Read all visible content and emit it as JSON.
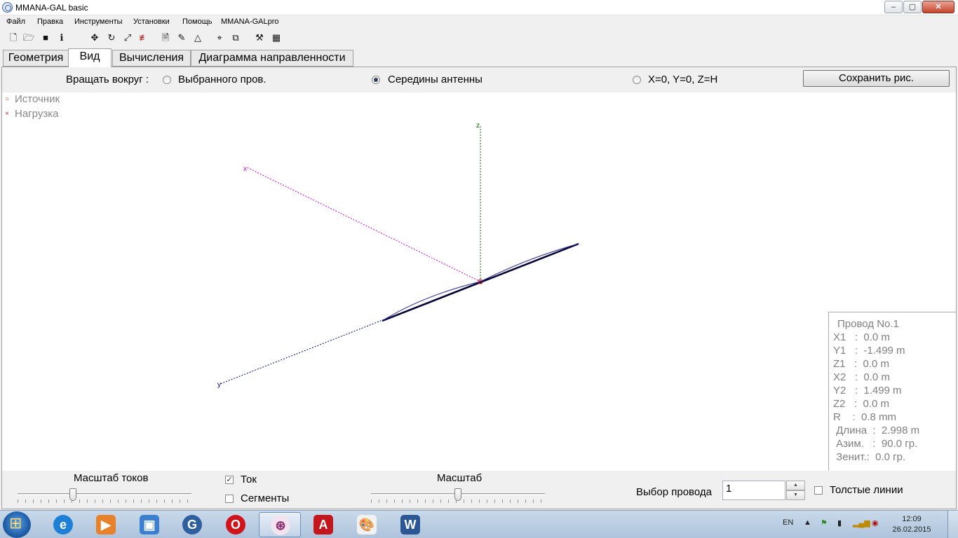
{
  "window": {
    "title": "MMANA-GAL basic"
  },
  "menu": [
    "Файл",
    "Правка",
    "Инструменты",
    "Установки",
    "Помощь",
    "MMANA-GALpro"
  ],
  "toolbar_icons": [
    "new-file-icon",
    "open-folder-icon",
    "save-icon",
    "info-icon",
    "move-icon",
    "rotate-icon",
    "scale-icon",
    "wires-icon",
    "page-icon",
    "edit-icon",
    "triangle-icon",
    "target-icon",
    "copy-icon",
    "tools-icon",
    "calculator-icon"
  ],
  "tabs": [
    "Геометрия",
    "Вид",
    "Вычисления",
    "Диаграмма направленности"
  ],
  "active_tab": "Вид",
  "rotate": {
    "label": "Вращать вокруг :",
    "options": [
      "Выбранного пров.",
      "Середины антенны",
      "X=0, Y=0, Z=H"
    ],
    "selected": "Середины антенны"
  },
  "save_button": "Сохранить рис.",
  "legend": {
    "source": "Источник",
    "load": "Нагрузка"
  },
  "wire_info": {
    "title": "Провод No.1",
    "rows": [
      "X1   :  0.0 m",
      "Y1   :  -1.499 m",
      "Z1   :  0.0 m",
      "X2   :  0.0 m",
      "Y2   :  1.499 m",
      "Z2   :  0.0 m",
      "R    :  0.8 mm",
      " Длина  :  2.998 m",
      " Азим.   :  90.0 гр.",
      " Зенит.:  0.0 гр."
    ]
  },
  "bottom": {
    "current_scale_label": "Масштаб токов",
    "current_scale_value": 0.32,
    "current_checkbox": {
      "label": "Ток",
      "checked": true
    },
    "segments_checkbox": {
      "label": "Сегменты",
      "checked": false
    },
    "scale_label": "Масштаб",
    "scale_value": 0.5,
    "wire_select_label": "Выбор провода",
    "wire_select_value": "1",
    "thick_lines": {
      "label": "Толстые линии",
      "checked": false
    }
  },
  "axes_colors": {
    "x": "#cc00cc",
    "y": "#000080",
    "z": "#006600"
  },
  "taskbar": {
    "apps": [
      "windows-explorer-icon",
      "internet-explorer-icon",
      "media-player-icon",
      "vm-icon",
      "chrome-like-icon",
      "opera-icon",
      "mmana-gal-icon",
      "acrobat-icon",
      "paint-icon",
      "word-icon"
    ],
    "lang": "EN",
    "time": "12:09",
    "date": "26.02.2015"
  }
}
